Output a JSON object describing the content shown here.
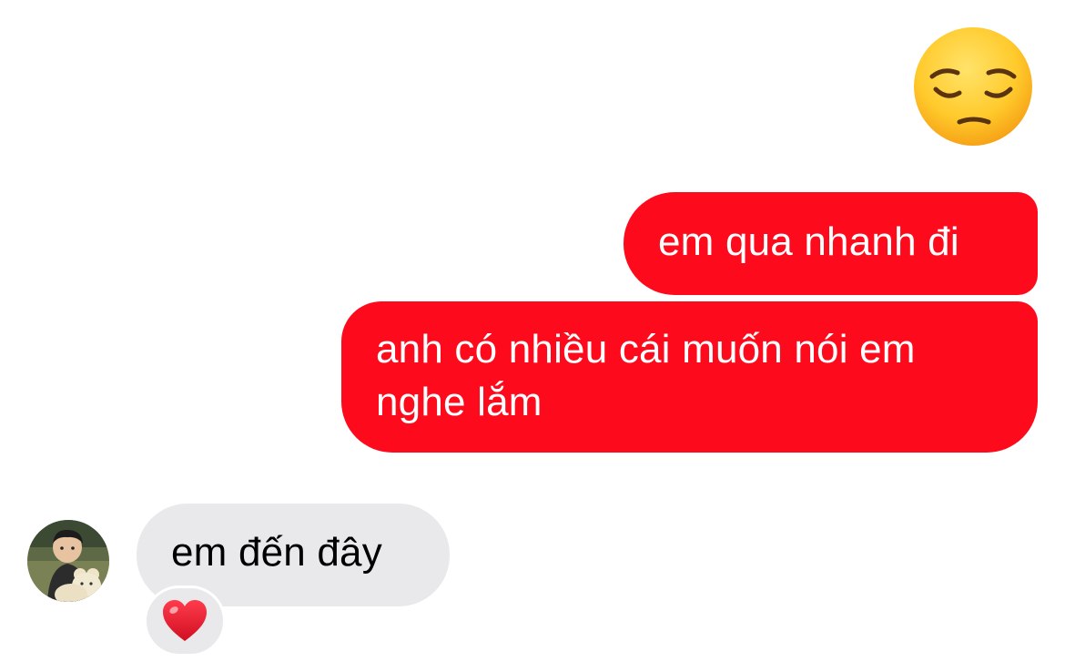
{
  "conversation": {
    "messages": [
      {
        "sender": "me",
        "type": "emoji",
        "emoji": "pensive-face-icon"
      },
      {
        "sender": "me",
        "type": "text",
        "text": "em qua nhanh đi"
      },
      {
        "sender": "me",
        "type": "text",
        "text": "anh có nhiều cái muốn nói em nghe lắm"
      },
      {
        "sender": "other",
        "type": "text",
        "text": "em đến đây",
        "reaction": "heart-icon"
      }
    ]
  },
  "colors": {
    "sent_bubble": "#fd0b1c",
    "received_bubble": "#e9e9eb",
    "sent_text": "#ffffff",
    "received_text": "#000000",
    "reaction_heart": "#e8162c"
  }
}
